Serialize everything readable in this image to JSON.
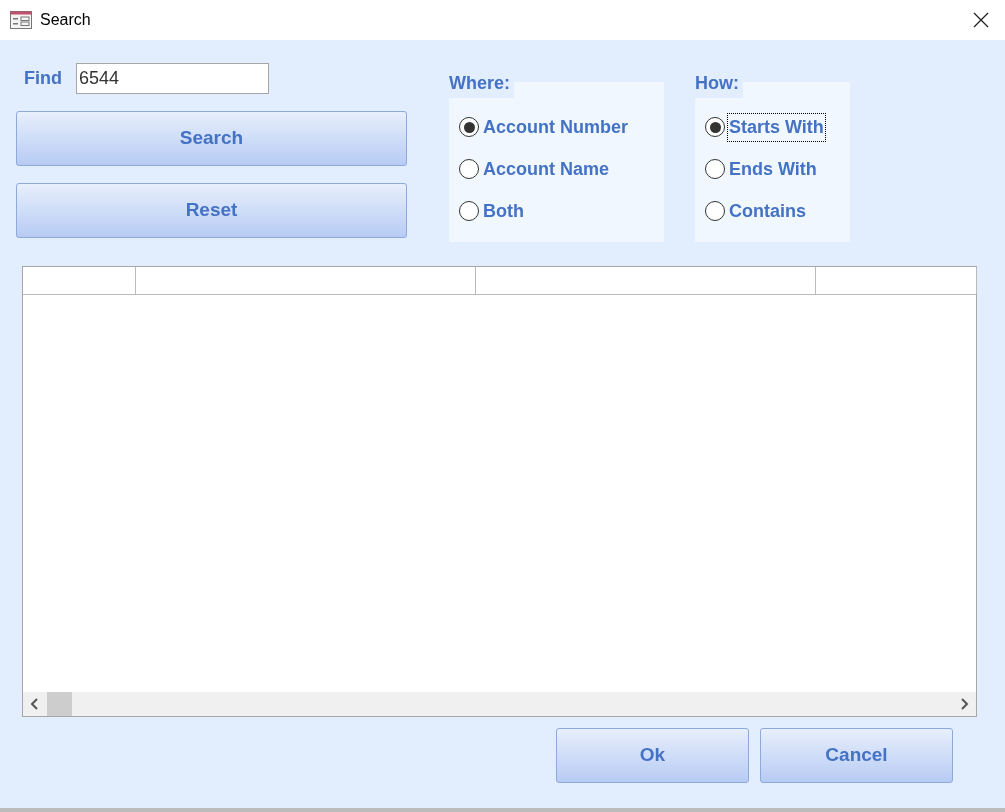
{
  "window": {
    "title": "Search"
  },
  "find": {
    "label": "Find",
    "value": "6544"
  },
  "buttons": [
    {
      "label": "Search"
    },
    {
      "label": "Reset"
    }
  ],
  "where": {
    "label": "Where:",
    "options": [
      {
        "label": "Account Number",
        "selected": true,
        "focused": false
      },
      {
        "label": "Account Name",
        "selected": false,
        "focused": false
      },
      {
        "label": "Both",
        "selected": false,
        "focused": false
      }
    ]
  },
  "how": {
    "label": "How:",
    "options": [
      {
        "label": "Starts With",
        "selected": true,
        "focused": true
      },
      {
        "label": "Ends With",
        "selected": false,
        "focused": false
      },
      {
        "label": "Contains",
        "selected": false,
        "focused": false
      }
    ]
  },
  "footer_buttons": [
    {
      "label": "Ok"
    },
    {
      "label": "Cancel"
    }
  ]
}
